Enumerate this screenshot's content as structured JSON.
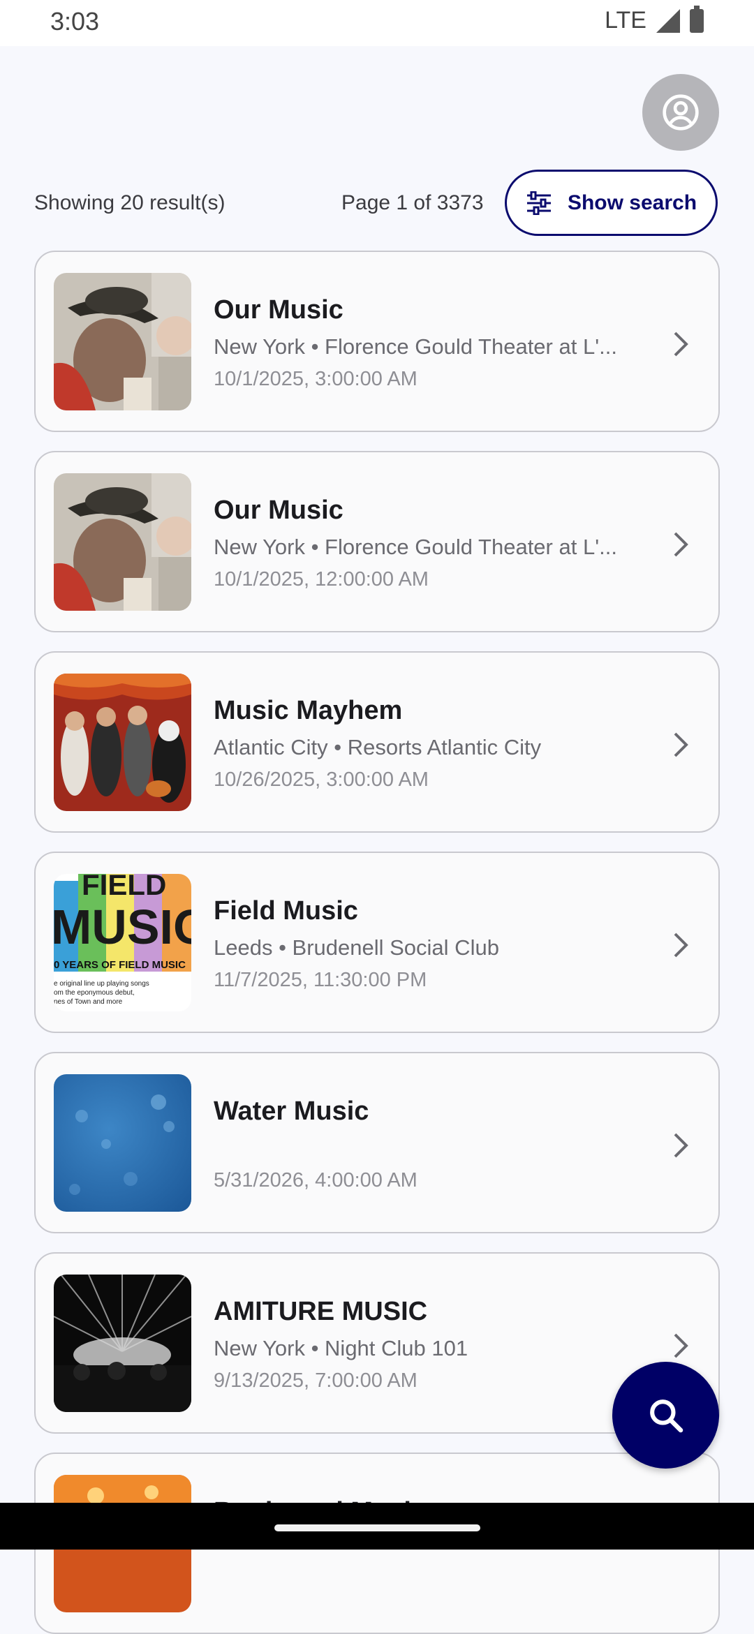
{
  "status_bar": {
    "time": "3:03",
    "network": "LTE"
  },
  "header": {
    "results_count": "Showing 20 result(s)",
    "page_info": "Page 1 of 3373",
    "show_search_label": "Show search"
  },
  "events": [
    {
      "title": "Our Music",
      "location": "New York • Florence Gould Theater at L'...",
      "datetime": "10/1/2025, 3:00:00 AM",
      "thumb": "man-in-hat-photo"
    },
    {
      "title": "Our Music",
      "location": "New York • Florence Gould Theater at L'...",
      "datetime": "10/1/2025, 12:00:00 AM",
      "thumb": "man-in-hat-photo"
    },
    {
      "title": "Music Mayhem",
      "location": "Atlantic City • Resorts Atlantic City",
      "datetime": "10/26/2025, 3:00:00 AM",
      "thumb": "rock-band-photo"
    },
    {
      "title": "Field Music",
      "location": "Leeds • Brudenell Social Club",
      "datetime": "11/7/2025, 11:30:00 PM",
      "thumb": "field-music-poster",
      "poster_text": {
        "line1": "FIELD",
        "line2": "MUSIC",
        "line3": "0 YEARS OF FIELD MUSIC",
        "line4": "e original line up playing songs",
        "line5": "om the eponymous debut,",
        "line6": "nes of Town and more"
      }
    },
    {
      "title": "Water Music",
      "location": "",
      "datetime": "5/31/2026, 4:00:00 AM",
      "thumb": "blue-water-texture"
    },
    {
      "title": "AMITURE MUSIC",
      "location": "New York • Night Club 101",
      "datetime": "9/13/2025, 7:00:00 AM",
      "thumb": "concert-lights-photo"
    },
    {
      "title": "Boulevard Music",
      "location": "",
      "datetime": "",
      "thumb": "orange-stage-photo"
    }
  ],
  "icons": {
    "avatar": "account-circle-icon",
    "filter": "tune-icon",
    "chevron": "chevron-right-icon",
    "fab": "search-icon"
  },
  "colors": {
    "accent": "#0b0b6e",
    "fab": "#000066",
    "background": "#f7f8fd"
  }
}
